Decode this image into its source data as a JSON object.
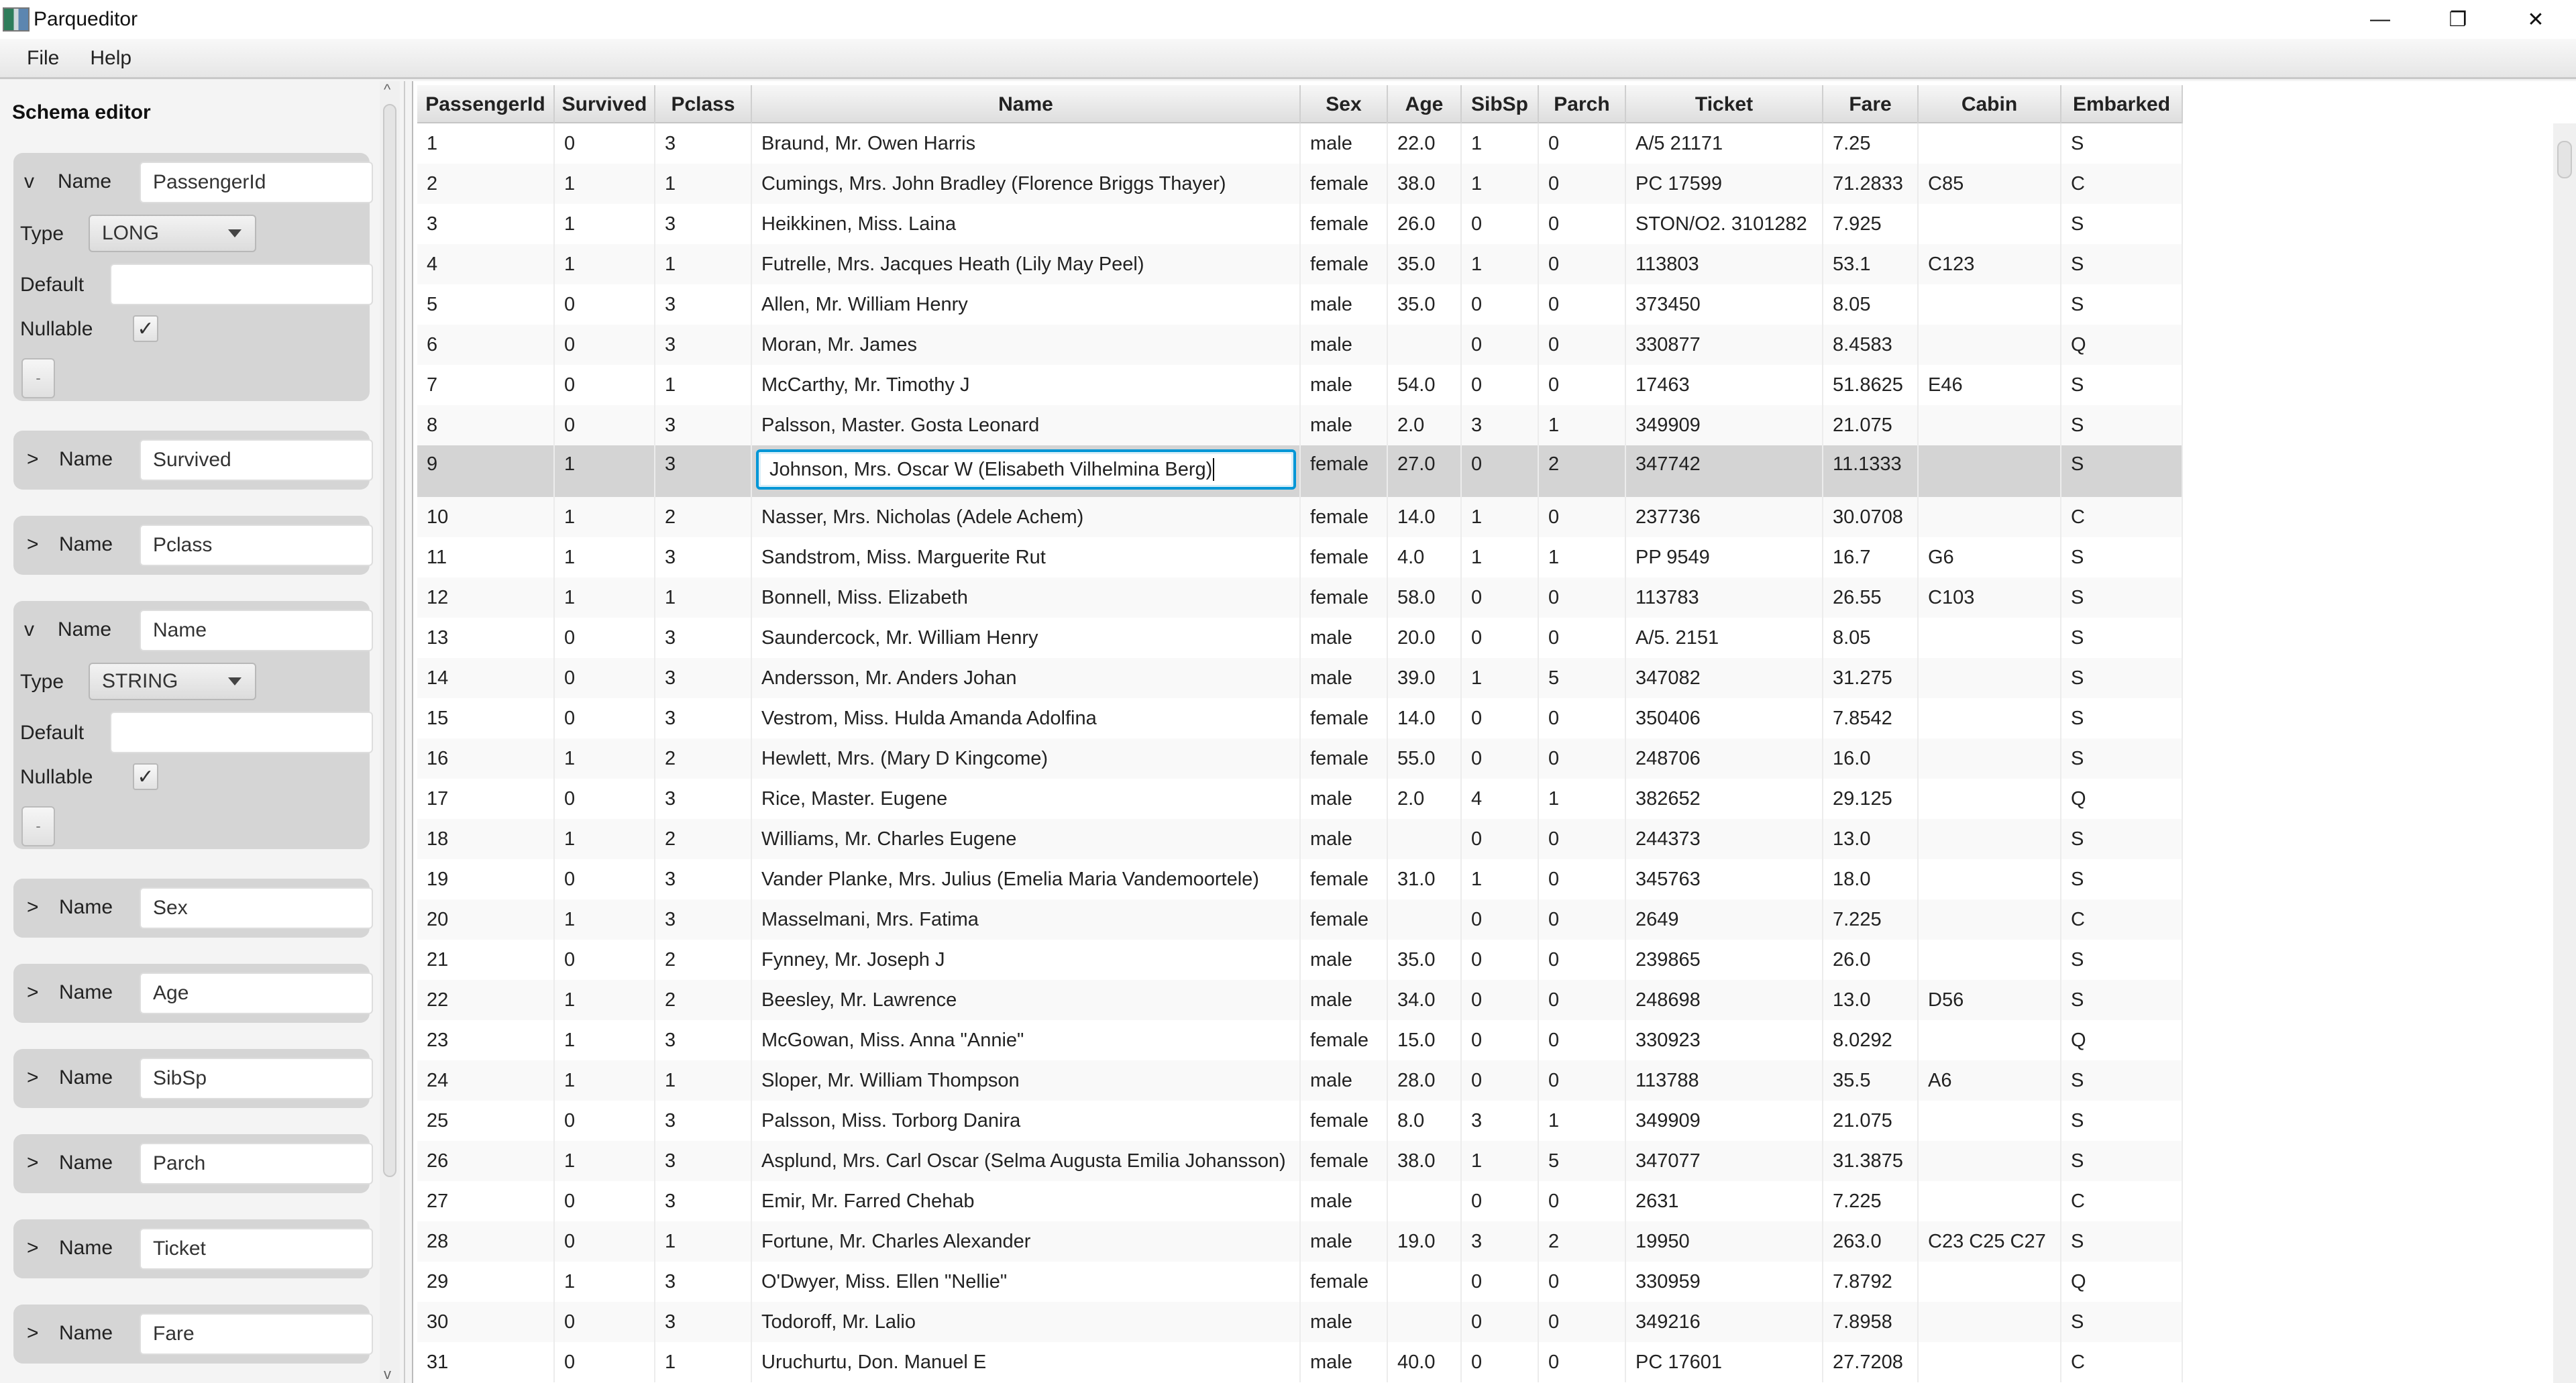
{
  "window": {
    "title": "Parqueditor",
    "minimize": "—",
    "restore": "❐",
    "close": "✕"
  },
  "menu": [
    "File",
    "Help"
  ],
  "schema_editor": {
    "title": "Schema editor",
    "name_label": "Name",
    "type_label": "Type",
    "default_label": "Default",
    "nullable_label": "Nullable",
    "remove_label": "-",
    "expand_open": "v",
    "expand_closed": ">",
    "check": "✓",
    "fields": [
      {
        "name": "PassengerId",
        "expanded": true,
        "type": "LONG",
        "default": "",
        "nullable": true
      },
      {
        "name": "Survived",
        "expanded": false
      },
      {
        "name": "Pclass",
        "expanded": false
      },
      {
        "name": "Name",
        "expanded": true,
        "type": "STRING",
        "default": "",
        "nullable": true
      },
      {
        "name": "Sex",
        "expanded": false
      },
      {
        "name": "Age",
        "expanded": false
      },
      {
        "name": "SibSp",
        "expanded": false
      },
      {
        "name": "Parch",
        "expanded": false
      },
      {
        "name": "Ticket",
        "expanded": false
      },
      {
        "name": "Fare",
        "expanded": false
      }
    ]
  },
  "table": {
    "columns": [
      "PassengerId",
      "Survived",
      "Pclass",
      "Name",
      "Sex",
      "Age",
      "SibSp",
      "Parch",
      "Ticket",
      "Fare",
      "Cabin",
      "Embarked"
    ],
    "selected_row": 8,
    "editing_value": "Johnson, Mrs. Oscar W (Elisabeth Vilhelmina Berg)",
    "rows": [
      [
        "1",
        "0",
        "3",
        "Braund, Mr. Owen Harris",
        "male",
        "22.0",
        "1",
        "0",
        "A/5 21171",
        "7.25",
        "",
        "S"
      ],
      [
        "2",
        "1",
        "1",
        "Cumings, Mrs. John Bradley (Florence Briggs Thayer)",
        "female",
        "38.0",
        "1",
        "0",
        "PC 17599",
        "71.2833",
        "C85",
        "C"
      ],
      [
        "3",
        "1",
        "3",
        "Heikkinen, Miss. Laina",
        "female",
        "26.0",
        "0",
        "0",
        "STON/O2. 3101282",
        "7.925",
        "",
        "S"
      ],
      [
        "4",
        "1",
        "1",
        "Futrelle, Mrs. Jacques Heath (Lily May Peel)",
        "female",
        "35.0",
        "1",
        "0",
        "113803",
        "53.1",
        "C123",
        "S"
      ],
      [
        "5",
        "0",
        "3",
        "Allen, Mr. William Henry",
        "male",
        "35.0",
        "0",
        "0",
        "373450",
        "8.05",
        "",
        "S"
      ],
      [
        "6",
        "0",
        "3",
        "Moran, Mr. James",
        "male",
        "",
        "0",
        "0",
        "330877",
        "8.4583",
        "",
        "Q"
      ],
      [
        "7",
        "0",
        "1",
        "McCarthy, Mr. Timothy J",
        "male",
        "54.0",
        "0",
        "0",
        "17463",
        "51.8625",
        "E46",
        "S"
      ],
      [
        "8",
        "0",
        "3",
        "Palsson, Master. Gosta Leonard",
        "male",
        "2.0",
        "3",
        "1",
        "349909",
        "21.075",
        "",
        "S"
      ],
      [
        "9",
        "1",
        "3",
        "Johnson, Mrs. Oscar W (Elisabeth Vilhelmina Berg)",
        "female",
        "27.0",
        "0",
        "2",
        "347742",
        "11.1333",
        "",
        "S"
      ],
      [
        "10",
        "1",
        "2",
        "Nasser, Mrs. Nicholas (Adele Achem)",
        "female",
        "14.0",
        "1",
        "0",
        "237736",
        "30.0708",
        "",
        "C"
      ],
      [
        "11",
        "1",
        "3",
        "Sandstrom, Miss. Marguerite Rut",
        "female",
        "4.0",
        "1",
        "1",
        "PP 9549",
        "16.7",
        "G6",
        "S"
      ],
      [
        "12",
        "1",
        "1",
        "Bonnell, Miss. Elizabeth",
        "female",
        "58.0",
        "0",
        "0",
        "113783",
        "26.55",
        "C103",
        "S"
      ],
      [
        "13",
        "0",
        "3",
        "Saundercock, Mr. William Henry",
        "male",
        "20.0",
        "0",
        "0",
        "A/5. 2151",
        "8.05",
        "",
        "S"
      ],
      [
        "14",
        "0",
        "3",
        "Andersson, Mr. Anders Johan",
        "male",
        "39.0",
        "1",
        "5",
        "347082",
        "31.275",
        "",
        "S"
      ],
      [
        "15",
        "0",
        "3",
        "Vestrom, Miss. Hulda Amanda Adolfina",
        "female",
        "14.0",
        "0",
        "0",
        "350406",
        "7.8542",
        "",
        "S"
      ],
      [
        "16",
        "1",
        "2",
        "Hewlett, Mrs. (Mary D Kingcome)",
        "female",
        "55.0",
        "0",
        "0",
        "248706",
        "16.0",
        "",
        "S"
      ],
      [
        "17",
        "0",
        "3",
        "Rice, Master. Eugene",
        "male",
        "2.0",
        "4",
        "1",
        "382652",
        "29.125",
        "",
        "Q"
      ],
      [
        "18",
        "1",
        "2",
        "Williams, Mr. Charles Eugene",
        "male",
        "",
        "0",
        "0",
        "244373",
        "13.0",
        "",
        "S"
      ],
      [
        "19",
        "0",
        "3",
        "Vander Planke, Mrs. Julius (Emelia Maria Vandemoortele)",
        "female",
        "31.0",
        "1",
        "0",
        "345763",
        "18.0",
        "",
        "S"
      ],
      [
        "20",
        "1",
        "3",
        "Masselmani, Mrs. Fatima",
        "female",
        "",
        "0",
        "0",
        "2649",
        "7.225",
        "",
        "C"
      ],
      [
        "21",
        "0",
        "2",
        "Fynney, Mr. Joseph J",
        "male",
        "35.0",
        "0",
        "0",
        "239865",
        "26.0",
        "",
        "S"
      ],
      [
        "22",
        "1",
        "2",
        "Beesley, Mr. Lawrence",
        "male",
        "34.0",
        "0",
        "0",
        "248698",
        "13.0",
        "D56",
        "S"
      ],
      [
        "23",
        "1",
        "3",
        "McGowan, Miss. Anna \"Annie\"",
        "female",
        "15.0",
        "0",
        "0",
        "330923",
        "8.0292",
        "",
        "Q"
      ],
      [
        "24",
        "1",
        "1",
        "Sloper, Mr. William Thompson",
        "male",
        "28.0",
        "0",
        "0",
        "113788",
        "35.5",
        "A6",
        "S"
      ],
      [
        "25",
        "0",
        "3",
        "Palsson, Miss. Torborg Danira",
        "female",
        "8.0",
        "3",
        "1",
        "349909",
        "21.075",
        "",
        "S"
      ],
      [
        "26",
        "1",
        "3",
        "Asplund, Mrs. Carl Oscar (Selma Augusta Emilia Johansson)",
        "female",
        "38.0",
        "1",
        "5",
        "347077",
        "31.3875",
        "",
        "S"
      ],
      [
        "27",
        "0",
        "3",
        "Emir, Mr. Farred Chehab",
        "male",
        "",
        "0",
        "0",
        "2631",
        "7.225",
        "",
        "C"
      ],
      [
        "28",
        "0",
        "1",
        "Fortune, Mr. Charles Alexander",
        "male",
        "19.0",
        "3",
        "2",
        "19950",
        "263.0",
        "C23 C25 C27",
        "S"
      ],
      [
        "29",
        "1",
        "3",
        "O'Dwyer, Miss. Ellen \"Nellie\"",
        "female",
        "",
        "0",
        "0",
        "330959",
        "7.8792",
        "",
        "Q"
      ],
      [
        "30",
        "0",
        "3",
        "Todoroff, Mr. Lalio",
        "male",
        "",
        "0",
        "0",
        "349216",
        "7.8958",
        "",
        "S"
      ],
      [
        "31",
        "0",
        "1",
        "Uruchurtu, Don. Manuel E",
        "male",
        "40.0",
        "0",
        "0",
        "PC 17601",
        "27.7208",
        "",
        "C"
      ]
    ]
  },
  "colors": {
    "selection_row": "#d4d4d4",
    "focus_border": "#0096d6",
    "card_bg": "#d5d5d5"
  }
}
